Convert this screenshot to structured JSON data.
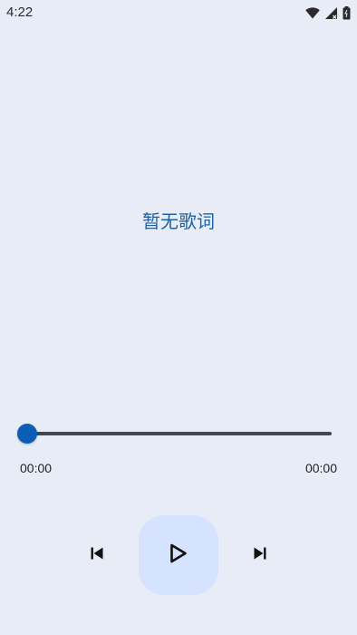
{
  "status_bar": {
    "time": "4:22",
    "icons": [
      "wifi-icon",
      "cellular-signal-icon",
      "battery-icon"
    ]
  },
  "lyrics": {
    "placeholder": "暂无歌词"
  },
  "player": {
    "current_time": "00:00",
    "total_time": "00:00",
    "progress": 0,
    "controls": {
      "previous": "skip-previous-icon",
      "play": "play-icon",
      "next": "skip-next-icon"
    }
  },
  "colors": {
    "background": "#e8ecf7",
    "accent": "#0b5db6",
    "lyrics_text": "#1a63a6",
    "play_button_bg": "#d6e3ff",
    "track": "#45464f"
  }
}
